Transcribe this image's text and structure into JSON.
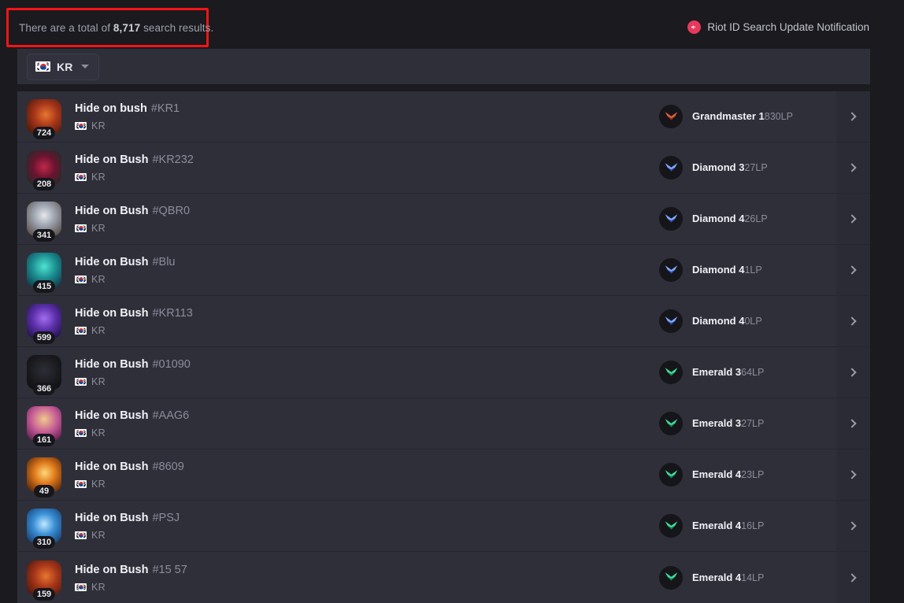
{
  "header": {
    "results_prefix": "There are a total of ",
    "results_count": "8,717",
    "results_suffix": " search results.",
    "notification_label": "Riot ID Search Update Notification",
    "notification_icon": "megaphone-icon",
    "notification_icon_glyph": "📢",
    "annotation_color": "#f41414"
  },
  "filter": {
    "region_label": "KR",
    "region_flag": "kr-flag-icon",
    "caret_icon": "chevron-down-icon"
  },
  "colors": {
    "page_bg": "#1a1a1f",
    "panel_bg": "#2f2f3a",
    "row_divider": "#26262e",
    "chevron_col_bg": "#2b2b35",
    "accent_red": "#e8395c"
  },
  "results": [
    {
      "level": "724",
      "game_name": "Hide on bush",
      "tag": "#KR1",
      "region": "KR",
      "tier": "Grandmaster 1",
      "lp": "830LP",
      "rank_class": "grandmaster",
      "portrait": "p0"
    },
    {
      "level": "208",
      "game_name": "Hide on Bush",
      "tag": "#KR232",
      "region": "KR",
      "tier": "Diamond 3",
      "lp": "27LP",
      "rank_class": "diamond",
      "portrait": "p1"
    },
    {
      "level": "341",
      "game_name": "Hide on Bush",
      "tag": "#QBR0",
      "region": "KR",
      "tier": "Diamond 4",
      "lp": "26LP",
      "rank_class": "diamond",
      "portrait": "p2"
    },
    {
      "level": "415",
      "game_name": "Hide on Bush",
      "tag": "#Blu",
      "region": "KR",
      "tier": "Diamond 4",
      "lp": "1LP",
      "rank_class": "diamond",
      "portrait": "p3"
    },
    {
      "level": "599",
      "game_name": "Hide on Bush",
      "tag": "#KR113",
      "region": "KR",
      "tier": "Diamond 4",
      "lp": "0LP",
      "rank_class": "diamond",
      "portrait": "p4"
    },
    {
      "level": "366",
      "game_name": "Hide on Bush",
      "tag": "#01090",
      "region": "KR",
      "tier": "Emerald 3",
      "lp": "64LP",
      "rank_class": "emerald",
      "portrait": "p5"
    },
    {
      "level": "161",
      "game_name": "Hide on Bush",
      "tag": "#AAG6",
      "region": "KR",
      "tier": "Emerald 3",
      "lp": "27LP",
      "rank_class": "emerald",
      "portrait": "p6"
    },
    {
      "level": "49",
      "game_name": "Hide on Bush",
      "tag": "#8609",
      "region": "KR",
      "tier": "Emerald 4",
      "lp": "23LP",
      "rank_class": "emerald",
      "portrait": "p7"
    },
    {
      "level": "310",
      "game_name": "Hide on Bush",
      "tag": "#PSJ",
      "region": "KR",
      "tier": "Emerald 4",
      "lp": "16LP",
      "rank_class": "emerald",
      "portrait": "p8"
    },
    {
      "level": "159",
      "game_name": "Hide on Bush",
      "tag": "#15 57",
      "region": "KR",
      "tier": "Emerald 4",
      "lp": "14LP",
      "rank_class": "emerald",
      "portrait": "p9"
    }
  ]
}
